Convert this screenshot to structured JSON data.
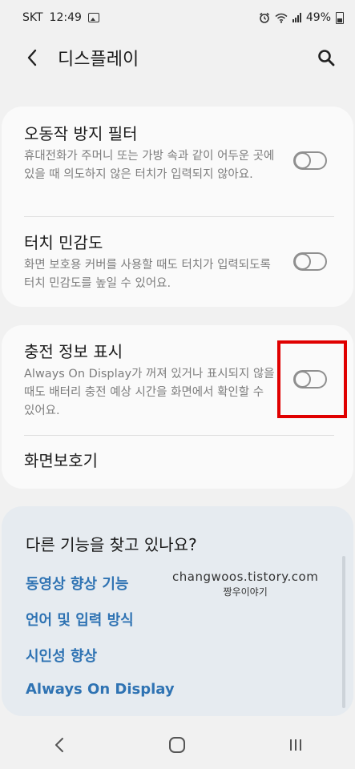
{
  "status": {
    "carrier": "SKT",
    "time": "12:49",
    "battery": "49%"
  },
  "header": {
    "title": "디스플레이"
  },
  "settings": [
    {
      "title": "오동작 방지 필터",
      "description": "휴대전화가 주머니 또는 가방 속과 같이 어두운 곳에 있을 때 의도하지 않은 터치가 입력되지 않아요.",
      "enabled": false
    },
    {
      "title": "터치 민감도",
      "description": "화면 보호용 커버를 사용할 때도 터치가 입력되도록 터치 민감도를 높일 수 있어요.",
      "enabled": false
    },
    {
      "title": "충전 정보 표시",
      "description": "Always On Display가 꺼져 있거나 표시되지 않을 때도 배터리 충전 예상 시간을 화면에서 확인할 수 있어요.",
      "enabled": false
    },
    {
      "title": "화면보호기"
    }
  ],
  "suggestions": {
    "title": "다른 기능을 찾고 있나요?",
    "links": [
      "동영상 향상 기능",
      "언어 및 입력 방식",
      "시인성 향상",
      "Always On Display"
    ]
  },
  "watermark": {
    "line1": "changwoos.tistory.com",
    "line2": "짱우이야기"
  },
  "icons": {
    "back": "chevron-left-icon",
    "search": "search-icon",
    "nav_back": "chevron-left-icon",
    "home": "home-icon",
    "recents": "recent-apps-icon"
  },
  "colors": {
    "link": "#2f73b3",
    "highlight": "#e00000",
    "toggle_off": "#8f8f8f"
  }
}
